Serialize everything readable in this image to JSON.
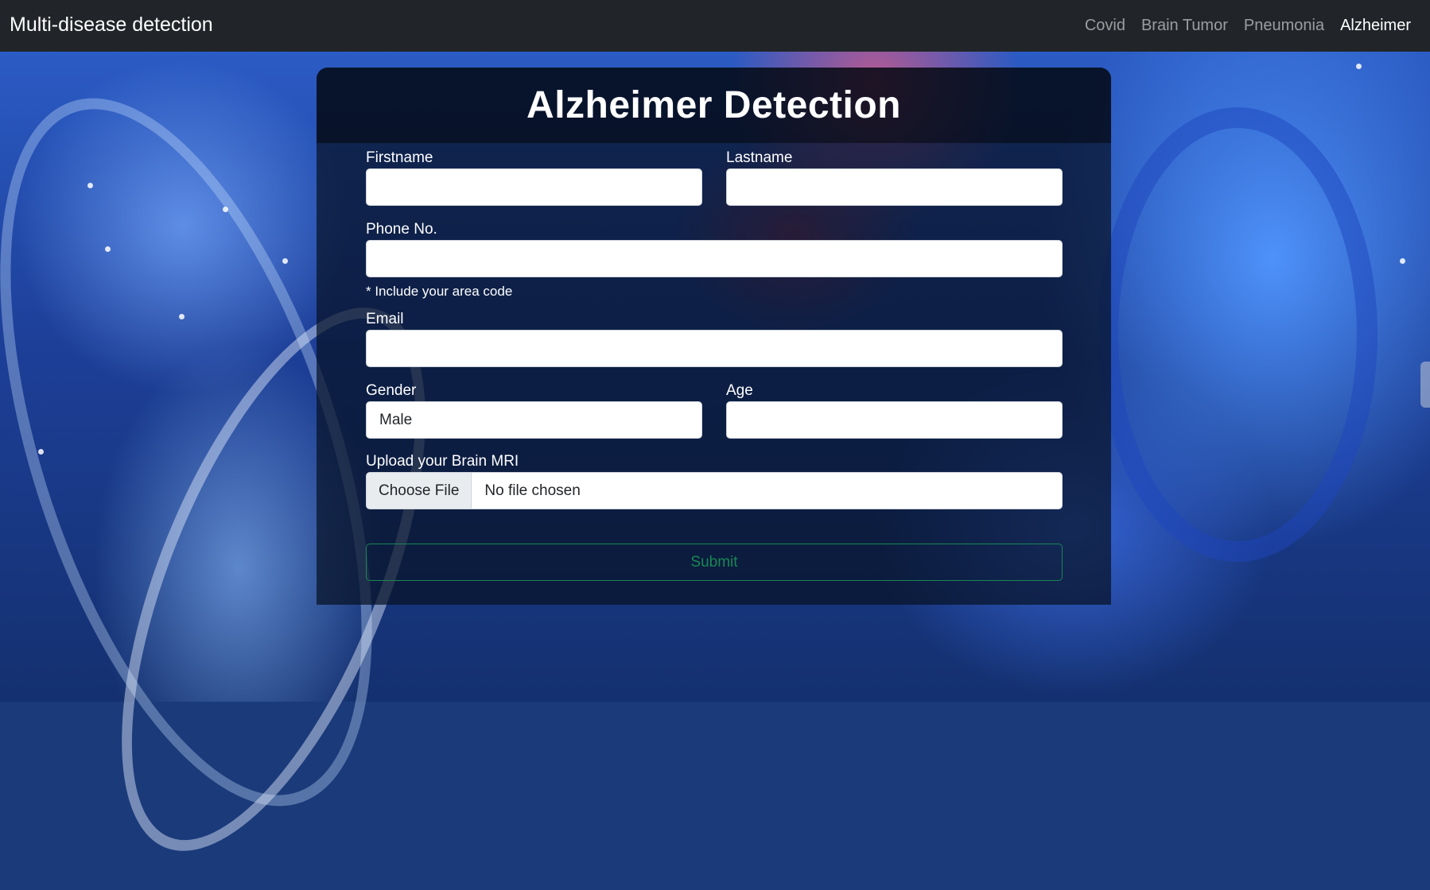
{
  "navbar": {
    "brand": "Multi-disease detection",
    "links": [
      {
        "label": "Covid",
        "active": false
      },
      {
        "label": "Brain Tumor",
        "active": false
      },
      {
        "label": "Pneumonia",
        "active": false
      },
      {
        "label": "Alzheimer",
        "active": true
      }
    ]
  },
  "form": {
    "title": "Alzheimer Detection",
    "firstname_label": "Firstname",
    "firstname_value": "",
    "lastname_label": "Lastname",
    "lastname_value": "",
    "phone_label": "Phone No.",
    "phone_value": "",
    "phone_hint": "* Include your area code",
    "email_label": "Email",
    "email_value": "",
    "gender_label": "Gender",
    "gender_value": "Male",
    "age_label": "Age",
    "age_value": "",
    "upload_label": "Upload your Brain MRI",
    "upload_button": "Choose File",
    "upload_status": "No file chosen",
    "submit_label": "Submit"
  },
  "colors": {
    "navbar_bg": "#212529",
    "submit_accent": "#198754"
  }
}
